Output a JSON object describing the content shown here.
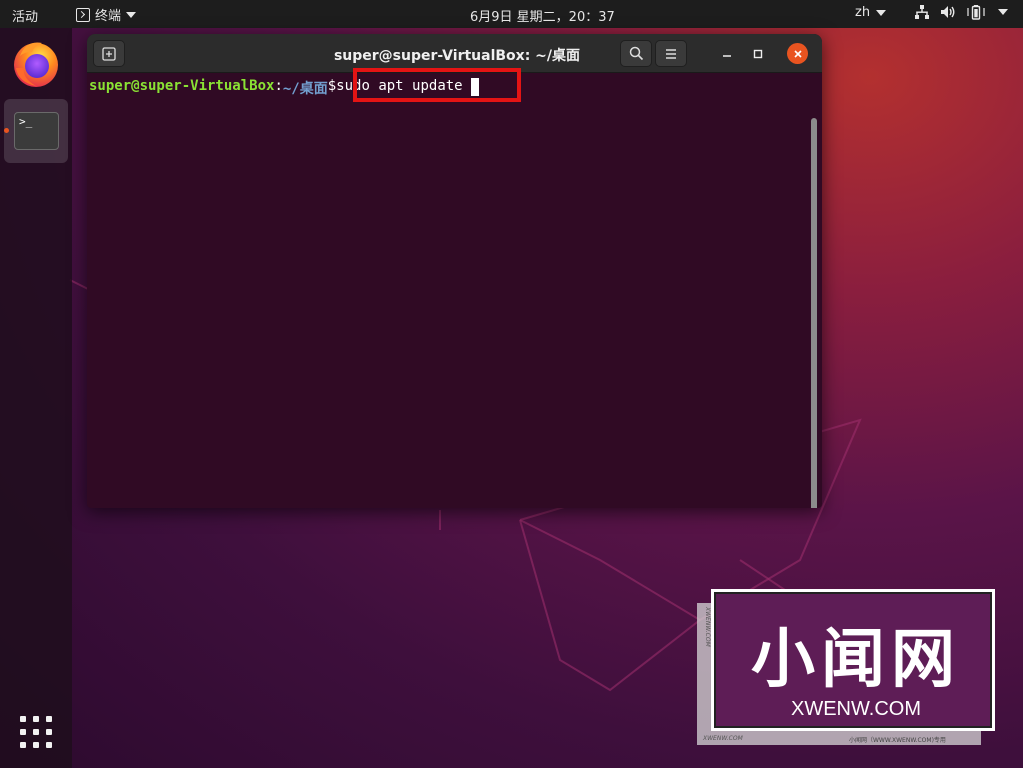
{
  "topbar": {
    "activities": "活动",
    "app_name": "终端",
    "clock": "6月9日 星期二，20：37",
    "language": "zh",
    "tray_icons": [
      "network-icon",
      "volume-icon",
      "battery-icon"
    ]
  },
  "dock": {
    "items": [
      {
        "name": "firefox",
        "icon": "firefox-icon"
      },
      {
        "name": "terminal",
        "icon": "terminal-icon",
        "glyph": ">_",
        "running": true
      }
    ],
    "apps_icon": "show-applications-icon"
  },
  "terminal": {
    "title": "super@super-VirtualBox: ~/桌面",
    "prompt": {
      "user_host": "super@super-VirtualBox",
      "colon": ":",
      "path": "~/桌面",
      "symbol": "$"
    },
    "command": "sudo apt update"
  },
  "watermark": {
    "title": "小闻网",
    "domain": "XWENW.COM",
    "side_text": "XWENW.COM",
    "bottom_left": "XWENW.COM",
    "bottom_right": "小闻网（WWW.XWENW.COM)专用"
  },
  "colors": {
    "topbar": "#1d1d1d",
    "terminal_bg": "#300a24",
    "prompt_user": "#8ae234",
    "prompt_path": "#729fcf",
    "accent": "#e95420",
    "highlight": "#e31414"
  }
}
